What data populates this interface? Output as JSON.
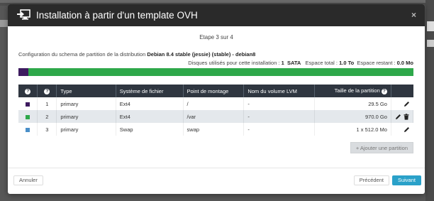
{
  "modal": {
    "title": "Installation à partir d'un template OVH",
    "close_label": "×"
  },
  "step": "Etape 3 sur 4",
  "description": {
    "prefix": "Configuration du schema de partition de la distribution ",
    "distribution": "Debian 8.4 stable (jessie) (stable) - debian8"
  },
  "disks": {
    "label": "Disques utilisés pour cette installation : ",
    "count": "1",
    "type": "SATA",
    "total_label": "Espace total : ",
    "total_value": "1.0 To",
    "remaining_label": "Espace restant : ",
    "remaining_value": "0.0 Mo"
  },
  "usage_bar": {
    "used_fraction": 0.025,
    "used_color": "#3d1b5f",
    "free_color": "#2ea84a"
  },
  "table": {
    "headers": {
      "type": "Type",
      "filesystem": "Système de fichier",
      "mountpoint": "Point de montage",
      "lvm": "Nom du volume LVM",
      "size": "Taille de la partition"
    },
    "rows": [
      {
        "color": "#3d1b5f",
        "num": "1",
        "type": "primary",
        "fs": "Ext4",
        "mount": "/",
        "lvm": "-",
        "size": "29.5 Go"
      },
      {
        "color": "#2ea84a",
        "num": "2",
        "type": "primary",
        "fs": "Ext4",
        "mount": "/var",
        "lvm": "-",
        "size": "970.0 Go"
      },
      {
        "color": "#4a8fc9",
        "num": "3",
        "type": "primary",
        "fs": "Swap",
        "mount": "swap",
        "lvm": "-",
        "size": "1 x 512.0 Mo"
      }
    ]
  },
  "buttons": {
    "add_partition": "+ Ajouter une partition",
    "cancel": "Annuler",
    "previous": "Précédent",
    "next": "Suivant"
  }
}
